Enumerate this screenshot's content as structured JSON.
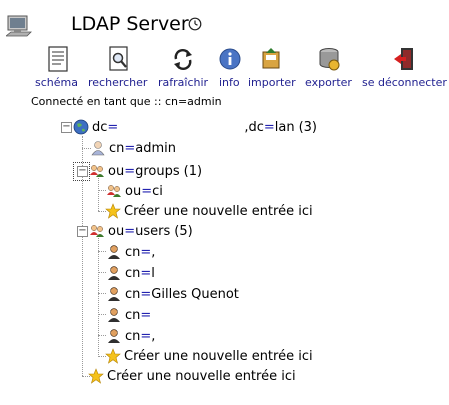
{
  "app": {
    "title": "LDAP Server"
  },
  "toolbar": [
    {
      "label": "schéma",
      "icon": "schema-icon"
    },
    {
      "label": "rechercher",
      "icon": "search-icon"
    },
    {
      "label": "rafraîchir",
      "icon": "refresh-icon"
    },
    {
      "label": "info",
      "icon": "info-icon"
    },
    {
      "label": "importer",
      "icon": "import-icon"
    },
    {
      "label": "exporter",
      "icon": "export-icon"
    },
    {
      "label": "se déconnecter",
      "icon": "logout-icon"
    }
  ],
  "session": {
    "logged_in_as": "Connecté en tant que :: cn=admin"
  },
  "tree": {
    "root": {
      "attr": "dc",
      "eq": "=",
      "suffix_attr": ",dc",
      "suffix_value": "lan",
      "count": "(3)"
    },
    "admin": {
      "attr": "cn",
      "eq": "=",
      "value": "admin"
    },
    "groups": {
      "attr": "ou",
      "eq": "=",
      "value": "groups",
      "count": "(1)"
    },
    "groups_child": {
      "attr": "ou",
      "eq": "=",
      "value": "ci"
    },
    "groups_create": "Créer une nouvelle entrée ici",
    "users": {
      "attr": "ou",
      "eq": "=",
      "value": "users",
      "count": "(5)"
    },
    "users_children": [
      {
        "attr": "cn",
        "eq": "=",
        "value": ","
      },
      {
        "attr": "cn",
        "eq": "=",
        "value": "l"
      },
      {
        "attr": "cn",
        "eq": "=",
        "value": "Gilles Quenot"
      },
      {
        "attr": "cn",
        "eq": "=",
        "value": ""
      },
      {
        "attr": "cn",
        "eq": "=",
        "value": ","
      }
    ],
    "users_create": "Créer une nouvelle entrée ici",
    "root_create": "Créer une nouvelle entrée ici"
  },
  "colors": {
    "link": "#1f1f8f",
    "equals": "#2323b0",
    "tree_lines": "#9a9a9a"
  }
}
